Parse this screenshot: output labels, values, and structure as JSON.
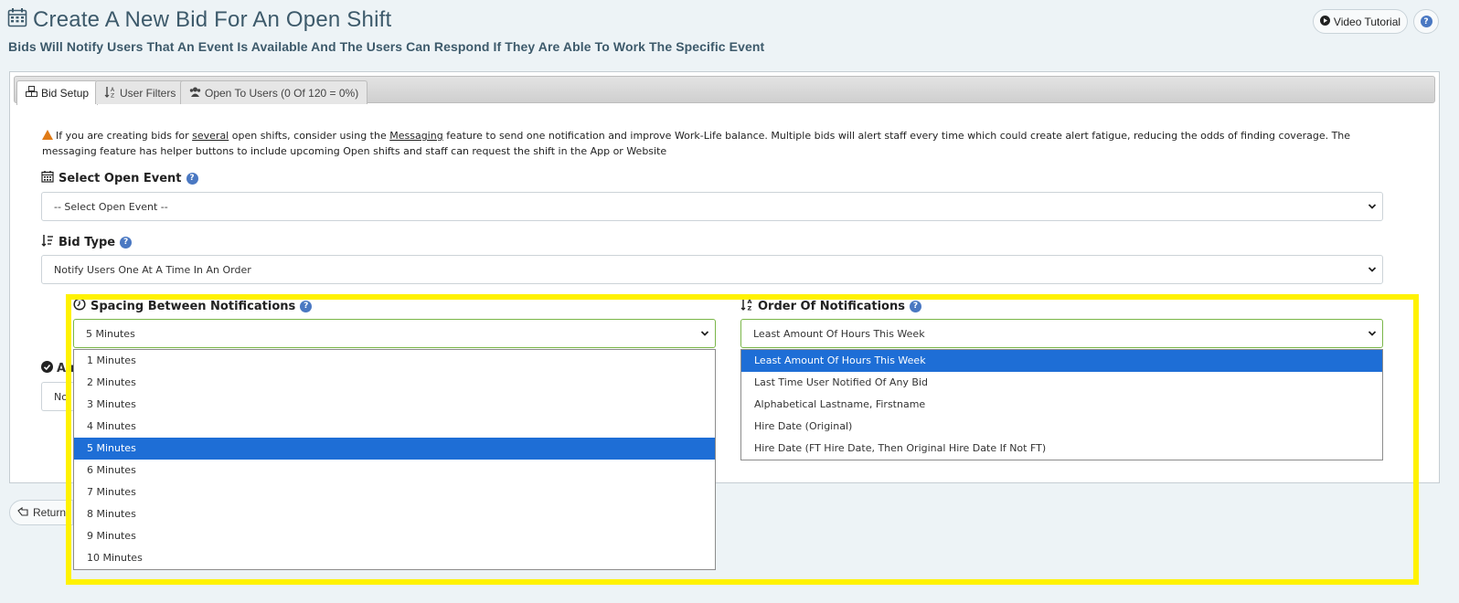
{
  "header": {
    "title": "Create A New Bid For An Open Shift",
    "subtitle": "Bids Will Notify Users That An Event Is Available And The Users Can Respond If They Are Able To Work The Specific Event",
    "video_tutorial_label": "Video Tutorial",
    "help_label": "?"
  },
  "tabs": [
    {
      "label": "Bid Setup",
      "icon": "cubes-icon",
      "active": true
    },
    {
      "label": "User Filters",
      "icon": "sort-alpha-icon",
      "active": false
    },
    {
      "label": "Open To Users (0 Of 120 = 0%)",
      "icon": "users-icon",
      "active": false
    }
  ],
  "notice": {
    "part1": "If you are creating bids for ",
    "link1": "several",
    "part2": " open shifts, consider using the ",
    "link2": "Messaging",
    "part3": " feature to send one notification and improve Work-Life balance. Multiple bids will alert staff every time which could create alert fatigue, reducing the odds of finding coverage. The messaging feature has helper buttons to include upcoming Open shifts and staff can request the shift in the App or Website"
  },
  "select_open_event": {
    "label": "Select Open Event",
    "value": "-- Select Open Event --"
  },
  "bid_type": {
    "label": "Bid Type",
    "value": "Notify Users One At A Time In An Order"
  },
  "spacing": {
    "label": "Spacing Between Notifications",
    "value": "5 Minutes",
    "options": [
      "1 Minutes",
      "2 Minutes",
      "3 Minutes",
      "4 Minutes",
      "5 Minutes",
      "6 Minutes",
      "7 Minutes",
      "8 Minutes",
      "9 Minutes",
      "10 Minutes"
    ],
    "selected_index": 4
  },
  "order": {
    "label": "Order Of Notifications",
    "value": "Least Amount Of Hours This Week",
    "options": [
      "Least Amount Of Hours This Week",
      "Last Time User Notified Of Any Bid",
      "Alphabetical Lastname, Firstname",
      "Hire Date (Original)",
      "Hire Date (FT Hire Date, Then Original Hire Date If Not FT)"
    ],
    "selected_index": 0
  },
  "partial": {
    "label_fragment": "Au",
    "select_fragment": "No",
    "return_label": "Return"
  },
  "colors": {
    "highlight": "#fff200",
    "selected_option": "#1e6ed6",
    "help_icon": "#4a78c2",
    "warning": "#e07b17"
  }
}
